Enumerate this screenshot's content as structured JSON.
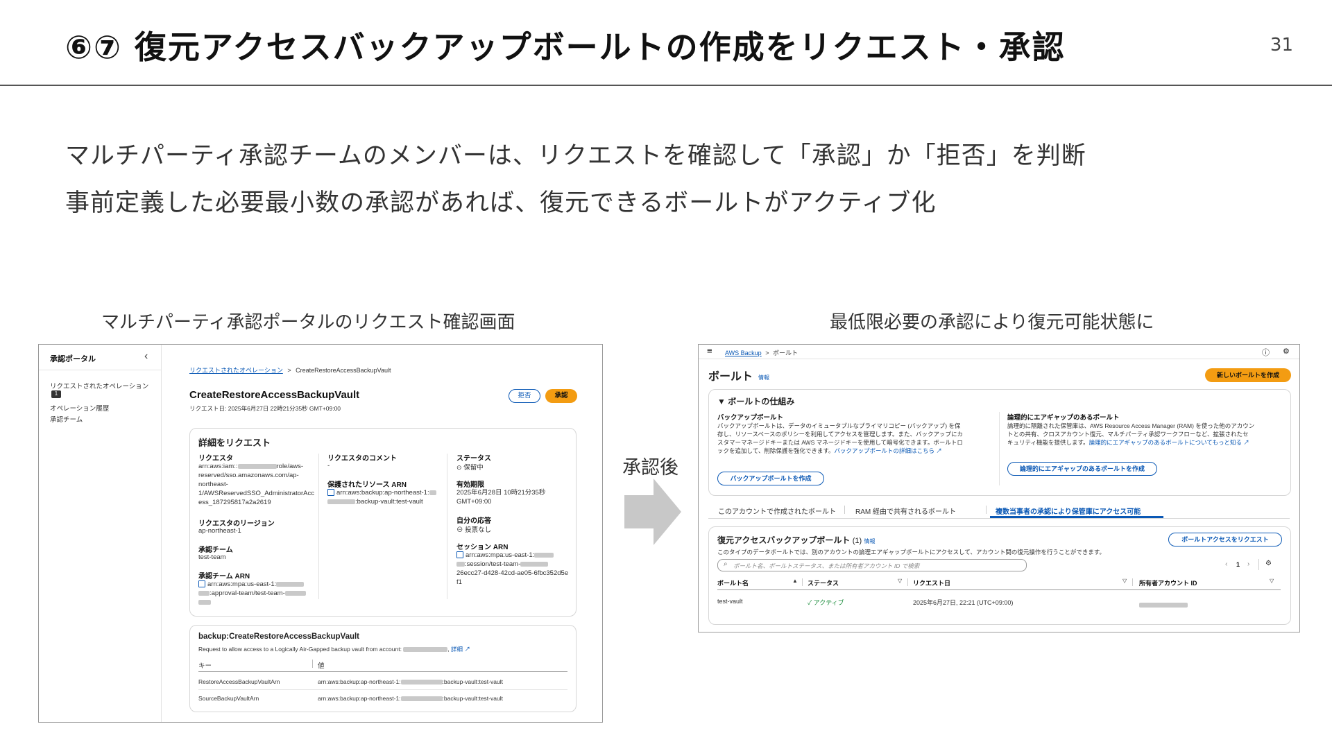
{
  "slide": {
    "title": "⑥⑦ 復元アクセスバックアップボールトの作成をリクエスト・承認",
    "page_number": "31",
    "lines": [
      "マルチパーティ承認チームのメンバーは、リクエストを確認して「承認」か「拒否」を判断",
      "事前定義した必要最小数の承認があれば、復元できるボールトがアクティブ化"
    ],
    "left_caption": "マルチパーティ承認ポータルのリクエスト確認画面",
    "right_caption": "最低限必要の承認により復元可能状態に",
    "arrow_label": "承認後"
  },
  "left": {
    "sidebar": {
      "title": "承認ポータル",
      "collapse": "‹",
      "items": [
        "リクエストされたオペレーション",
        "オペレーション履歴",
        "承認チーム"
      ],
      "badge": "1"
    },
    "breadcrumb": {
      "parent": "リクエストされたオペレーション",
      "sep": ">",
      "current": "CreateRestoreAccessBackupVault"
    },
    "header": {
      "title": "CreateRestoreAccessBackupVault",
      "subtitle": "リクエスト日: 2025年6月27日 22時21分35秒 GMT+09:00",
      "reject": "拒否",
      "approve": "承認"
    },
    "details": {
      "title": "詳細をリクエスト",
      "requester_label": "リクエスタ",
      "requester_lines": [
        "arn:aws:iam::",
        "role/aws-",
        "reserved/sso.amazonaws.com/ap-",
        "northeast-",
        "1/AWSReservedSSO_AdministratorAcc",
        "ess_187295817a2a2619"
      ],
      "region_label": "リクエスタのリージョン",
      "region_value": "ap-northeast-1",
      "team_label": "承認チーム",
      "team_value": "test-team",
      "team_arn_label": "承認チーム ARN",
      "team_arn_lines": [
        "arn:aws:mpa:us-east-1:",
        ":approval-team/test-team-"
      ],
      "comment_label": "リクエスタのコメント",
      "comment_value": "-",
      "resource_label": "保護されたリソース ARN",
      "resource_lines": [
        "arn:aws:backup:ap-northeast-1:",
        ":backup-vault:test-vault"
      ],
      "status_label": "ステータス",
      "status_value": "保留中",
      "expiry_label": "有効期限",
      "expiry_lines": [
        "2025年6月28日 10時21分35秒",
        "GMT+09:00"
      ],
      "response_label": "自分の応答",
      "response_value": "投票なし",
      "session_label": "セッション ARN",
      "session_lines": [
        "arn:aws:mpa:us-east-1:",
        ":session/test-team-",
        "26ecc27-d428-42cd-ae05-6fbc352d5e",
        "f1"
      ]
    },
    "operation": {
      "title": "backup:CreateRestoreAccessBackupVault",
      "desc": "Request to allow access to a Logically Air-Gapped backup vault from account:",
      "detail_link": "詳細",
      "col_key": "キー",
      "col_value": "値",
      "rows": [
        {
          "key": "RestoreAccessBackupVaultArn",
          "value_pre": "arn:aws:backup:ap-northeast-1:",
          "value_post": ":backup-vault:test-vault"
        },
        {
          "key": "SourceBackupVaultArn",
          "value_pre": "arn:aws:backup:ap-northeast-1:",
          "value_post": ":backup-vault:test-vault"
        }
      ]
    }
  },
  "right": {
    "topbar": {
      "menu": "≡",
      "service": "AWS Backup",
      "sep": ">",
      "page": "ボールト",
      "info": "ⓘ",
      "settings": "⚙"
    },
    "header": {
      "title": "ボールト",
      "info": "情報",
      "create": "新しいボールトを作成"
    },
    "how": {
      "title": "▼ ボールトの仕組み",
      "backup_title": "バックアップボールト",
      "backup_desc": [
        "バックアップボールトは、データのイミュータブルなプライマリコピー (バックアップ) を保",
        "存し、リソースベースのポリシーを利用してアクセスを管理します。また、バックアップにカ",
        "スタマーマネージドキーまたは AWS マネージドキーを使用して暗号化できます。ボールトロ",
        "ックを追加して、削除保護を強化できます。"
      ],
      "backup_link": "バックアップボールトの詳細はこちら",
      "backup_button": "バックアップボールトを作成",
      "airgap_title": "論理的にエアギャップのあるボールト",
      "airgap_desc": [
        "論理的に隔離された保管庫は、AWS Resource Access Manager (RAM) を使った他のアカウン",
        "トとの共有、クロスアカウント復元、マルチパーティ承認ワークフローなど、拡張されたセ",
        "キュリティ機能を提供します。"
      ],
      "airgap_link": "論理的にエアギャップのあるボールトについてもっと知る",
      "airgap_button": "論理的にエアギャップのあるボールトを作成"
    },
    "tabs": [
      "このアカウントで作成されたボールト",
      "RAM 経由で共有されるボールト",
      "複数当事者の承認により保管庫にアクセス可能"
    ],
    "table": {
      "title": "復元アクセスバックアップボールト",
      "count": "(1)",
      "info": "情報",
      "request_button": "ボールトアクセスをリクエスト",
      "desc": "このタイプのデータボールトでは、別のアカウントの論理エアギャップボールトにアクセスして、アカウント間の復元操作を行うことができます。",
      "search_placeholder": "ボールト名、ボールトステータス、または所有者アカウント ID で検索",
      "page": "1",
      "cols": [
        "ボールト名",
        "ステータス",
        "リクエスト日",
        "所有者アカウント ID"
      ],
      "row": {
        "name": "test-vault",
        "status": "アクティブ",
        "date": "2025年6月27日, 22:21 (UTC+09:00)"
      }
    }
  },
  "colors": {
    "orange": "#f39c12",
    "link": "#0a58b5",
    "arrow": "#c8c8c8",
    "green": "#1e8e3e"
  }
}
